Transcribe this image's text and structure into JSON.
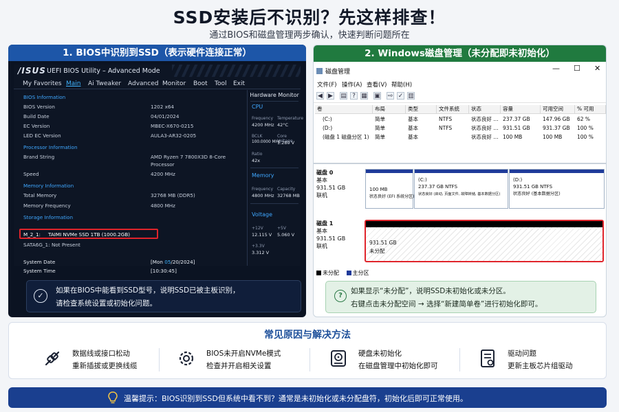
{
  "header": {
    "title": "SSD安装后不识别？先这样排查！",
    "subtitle": "通过BIOS和磁盘管理两步确认，快速判断问题所在"
  },
  "left_panel": {
    "heading": "1. BIOS中识别到SSD（表示硬件连接正常）",
    "bios": {
      "brand": "/ISUS",
      "title": "UEFI BIOS Utility – Advanced Mode",
      "menu": [
        "My Favorites",
        "Main",
        "Ai Tweaker",
        "Advanced",
        "Monitor",
        "Boot",
        "Tool",
        "Exit"
      ],
      "active_menu": "Main",
      "sections": {
        "bios_info": "BIOS Information",
        "processor_info": "Processor Information",
        "memory_info": "Memory Information",
        "storage_info": "Storage Information"
      },
      "rows": {
        "bios_version": {
          "label": "BIOS Version",
          "value": "1202  x64"
        },
        "build_date": {
          "label": "Build Date",
          "value": "04/01/2024"
        },
        "ec_version": {
          "label": "EC Version",
          "value": "MBEC-X670-0215"
        },
        "led_ec_version": {
          "label": "LED EC Version",
          "value": "AULA3-AR32-0205"
        },
        "brand_string": {
          "label": "Brand String",
          "value": "AMD Ryzen 7 7800X3D 8-Core",
          "value2": "Processor"
        },
        "speed": {
          "label": "Speed",
          "value": "4200 MHz"
        },
        "total_memory": {
          "label": "Total Memory",
          "value": "32768 MB (DDR5)"
        },
        "memory_frequency": {
          "label": "Memory Frequency",
          "value": "4800 MHz"
        },
        "m2_1": {
          "label": "M_2_1:",
          "value": "TAIMI NVMe SSD 1TB (1000.2GB)"
        },
        "sata6g_1": {
          "label": "SATA6G_1:",
          "value": "Not Present"
        },
        "system_date": {
          "label": "System Date",
          "value_pre": "[Mon ",
          "value_hl": "05",
          "value_post": "/20/2024]"
        },
        "system_time": {
          "label": "System Time",
          "value": "[10:30:45]"
        }
      },
      "hardware_monitor": {
        "title": "Hardware Monitor",
        "cpu": "CPU",
        "frequency_label": "Frequency",
        "frequency": "4200 MHz",
        "temperature_label": "Temperature",
        "temperature": "42°C",
        "bclk_label": "BCLK",
        "bclk": "100.0000 MHz",
        "core_voltage_label": "Core Voltage",
        "core_voltage": "1.280 V",
        "ratio_label": "Ratio",
        "ratio": "42x",
        "memory": "Memory",
        "mem_freq_label": "Frequency",
        "mem_freq": "4800 MHz",
        "capacity_label": "Capacity",
        "capacity": "32768 MB",
        "voltage": "Voltage",
        "v12_label": "+12V",
        "v12": "12.115 V",
        "v5_label": "+5V",
        "v5": "5.060 V",
        "v33_label": "+3.3V",
        "v33": "3.312 V"
      }
    },
    "note_line1": "如果在BIOS中能看到SSD型号，说明SSD已被主板识别，",
    "note_line2": "请检查系统设置或初始化问题。"
  },
  "right_panel": {
    "heading": "2. Windows磁盘管理（未分配即未初始化）",
    "window_title": "磁盘管理",
    "window_controls": [
      "—",
      "☐",
      "✕"
    ],
    "menu": [
      "文件(F)",
      "操作(A)",
      "查看(V)",
      "帮助(H)"
    ],
    "table": {
      "headers": [
        "卷",
        "布局",
        "类型",
        "文件系统",
        "状态",
        "容量",
        "可用空间",
        "% 可用"
      ],
      "rows": [
        [
          "(C:)",
          "简单",
          "基本",
          "NTFS",
          "状态良好 ...",
          "237.37 GB",
          "147.96 GB",
          "62 %"
        ],
        [
          "(D:)",
          "简单",
          "基本",
          "NTFS",
          "状态良好 ...",
          "931.51 GB",
          "931.37 GB",
          "100 %"
        ],
        [
          "(磁盘 1 磁盘分区 1)",
          "简单",
          "基本",
          "",
          "状态良好 ...",
          "100 MB",
          "100 MB",
          "100 %"
        ]
      ]
    },
    "disk0": {
      "name": "磁盘 0",
      "type": "基本",
      "size": "931.51 GB",
      "status": "联机",
      "partitions": [
        {
          "l1": "",
          "l2": "100 MB",
          "l3": "状态良好 (EFI 系统分区)"
        },
        {
          "l1": "(C:)",
          "l2": "237.37 GB NTFS",
          "l3": "状态良好 (启动, 页面文件, 故障转储, 基本数据分区)"
        },
        {
          "l1": "(D:)",
          "l2": "931.51 GB NTFS",
          "l3": "状态良好 (基本数据分区)"
        }
      ]
    },
    "disk1": {
      "name": "磁盘 1",
      "type": "基本",
      "size": "931.51 GB",
      "status": "联机",
      "unalloc_size": "931.51 GB",
      "unalloc_label": "未分配"
    },
    "legend": {
      "unallocated": "未分配",
      "primary": "主分区"
    },
    "note_line1": "如果显示“未分配”，说明SSD未初始化或未分区。",
    "note_line2": "右键点击未分配空间 → 选择“新建简单卷”进行初始化即可。"
  },
  "causes": {
    "title": "常见原因与解决方法",
    "items": [
      {
        "icon": "cable-icon",
        "title": "数据线或接口松动",
        "desc": "重新插拔或更换线缆"
      },
      {
        "icon": "gear-icon",
        "title": "BIOS未开启NVMe模式",
        "desc": "检查并开启相关设置"
      },
      {
        "icon": "disk-icon",
        "title": "硬盘未初始化",
        "desc": "在磁盘管理中初始化即可"
      },
      {
        "icon": "driver-icon",
        "title": "驱动问题",
        "desc": "更新主板芯片组驱动"
      }
    ]
  },
  "tip": "温馨提示：BIOS识别到SSD但系统中看不到？通常是未初始化或未分配盘符，初始化后即可正常使用。",
  "colors": {
    "bios_accent": "#3fa7ff",
    "left_heading": "#1d56a8",
    "right_heading": "#207a3f",
    "highlight": "#e0242b",
    "tip_bg": "#1a3f8f"
  }
}
